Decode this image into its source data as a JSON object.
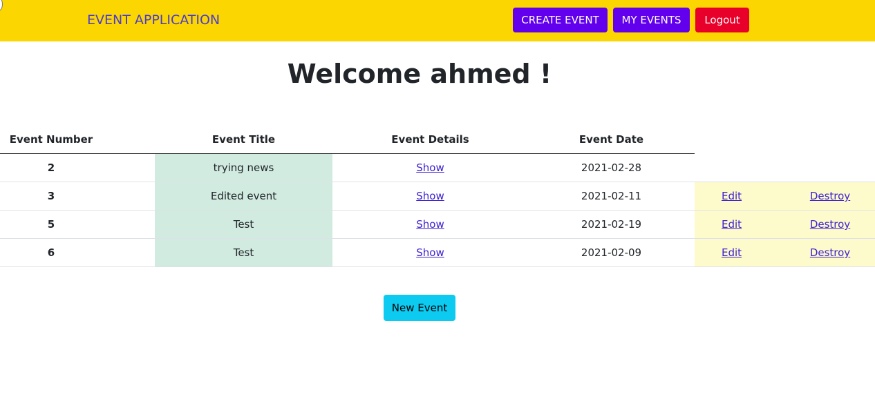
{
  "navbar": {
    "brand": "EVENT APPLICATION",
    "create_event": "CREATE EVENT",
    "my_events": "MY EVENTS",
    "logout": "Logout"
  },
  "welcome": "Welcome ahmed !",
  "table": {
    "headers": [
      "Event Number",
      "Event Title",
      "Event Details",
      "Event Date"
    ],
    "rows": [
      {
        "number": "2",
        "title": "trying news",
        "details": "Show",
        "date": "2021-02-28",
        "edit": "",
        "destroy": ""
      },
      {
        "number": "3",
        "title": "Edited event",
        "details": "Show",
        "date": "2021-02-11",
        "edit": "Edit",
        "destroy": "Destroy"
      },
      {
        "number": "5",
        "title": "Test",
        "details": "Show",
        "date": "2021-02-19",
        "edit": "Edit",
        "destroy": "Destroy"
      },
      {
        "number": "6",
        "title": "Test",
        "details": "Show",
        "date": "2021-02-09",
        "edit": "Edit",
        "destroy": "Destroy"
      }
    ]
  },
  "new_event": "New Event",
  "colors": {
    "navbar": "#fcd600",
    "primary": "#6200ee",
    "danger": "#e8002a",
    "info": "#0dcaf0",
    "title_column": "#d1ebe0",
    "actions_column": "#fdfacc"
  }
}
